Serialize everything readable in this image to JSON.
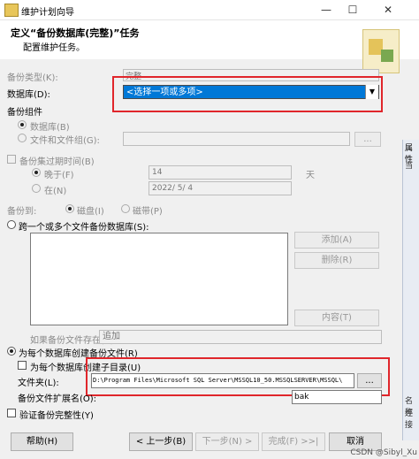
{
  "window": {
    "title": "维护计划向导",
    "minimize": "—",
    "maximize": "☐",
    "close": "✕"
  },
  "header": {
    "title": "定义“备份数据库(完整)”任务",
    "subtitle": "配置维护任务。"
  },
  "backup_type": {
    "label": "备份类型(K):",
    "value": "完整"
  },
  "database": {
    "label": "数据库(D):",
    "value": "<选择一项或多项>"
  },
  "component": {
    "label": "备份组件",
    "database_radio": "数据库(B)",
    "files_radio": "文件和文件组(G):",
    "browse": "..."
  },
  "expire": {
    "check_label": "备份集过期时间(B)",
    "after_radio": "晚于(F)",
    "after_value": "14",
    "after_unit": "天",
    "on_radio": "在(N)",
    "on_value": "2022/ 5/ 4"
  },
  "backup_to": {
    "label": "备份到:",
    "disk": "磁盘(I)",
    "tape": "磁带(P)"
  },
  "across_files": {
    "radio_label": "跨一个或多个文件备份数据库(S):",
    "add": "添加(A)",
    "remove": "删除(R)",
    "contents": "内容(T)",
    "if_exists_label": "如果备份文件存在(X):",
    "if_exists_value": "追加"
  },
  "per_database": {
    "radio_label": "为每个数据库创建备份文件(R)",
    "subdir_label": "为每个数据库创建子目录(U)",
    "folder_label": "文件夹(L):",
    "folder_value": "D:\\Program Files\\Microsoft SQL Server\\MSSQL10_50.MSSQLSERVER\\MSSQL\\",
    "browse": "...",
    "ext_label": "备份文件扩展名(O):",
    "ext_value": "bak"
  },
  "verify": {
    "label": "验证备份完整性(Y)"
  },
  "footer": {
    "help": "帮助(H)",
    "back": "< 上一步(B)",
    "next": "下一步(N) >",
    "finish": "完成(F) >>|",
    "cancel": "取消"
  },
  "side_panel": {
    "title": "属性",
    "row1": "当",
    "row2": "名称",
    "row3": "连接"
  },
  "watermark": "CSDN @Sibyl_Xu",
  "colors": {
    "accent": "#0078d7",
    "highlight_border": "#e0262b"
  }
}
